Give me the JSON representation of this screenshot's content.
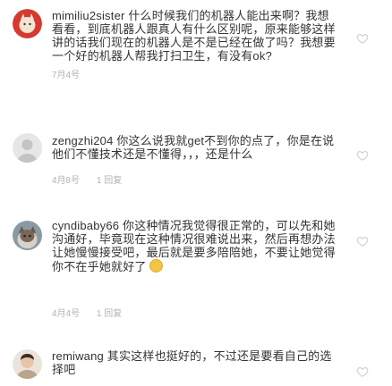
{
  "comments": [
    {
      "username": "mimiliu2sister",
      "text": "什么时候我们的机器人能出来啊？我想看看，到底机器人跟真人有什么区别呢，原来能够这样讲的话我们现在的机器人是不是已经在做了吗？我想要一个好的机器人帮我打扫卫生，有没有ok?",
      "time": "7月4号",
      "replies": "",
      "avatar": "red-cat-avatar"
    },
    {
      "username": "zengzhi204",
      "text": "你这么说我就get不到你的点了，你是在说他们不懂技术还是不懂得，，，还是什么",
      "time": "4月8号",
      "replies": "1 回复",
      "avatar": "gray-placeholder-avatar"
    },
    {
      "username": "cyndibaby66",
      "text": "你这种情况我觉得很正常的，可以先和她沟通好，毕竟现在这种情况很难说出来，然后再想办法让她慢慢接受吧，最后就是要多陪陪她，不要让她觉得你不在乎她就好了",
      "time": "4月4号",
      "replies": "1 回复",
      "avatar": "cat-photo-avatar"
    },
    {
      "username": "remiwang",
      "text": "其实这样也挺好的，不过还是要看自己的选择吧",
      "time": "",
      "replies": "",
      "avatar": "person-photo-avatar"
    }
  ],
  "colors": {
    "meta": "#b2b2b2",
    "heart": "#c8c8c8",
    "text": "#333333"
  }
}
